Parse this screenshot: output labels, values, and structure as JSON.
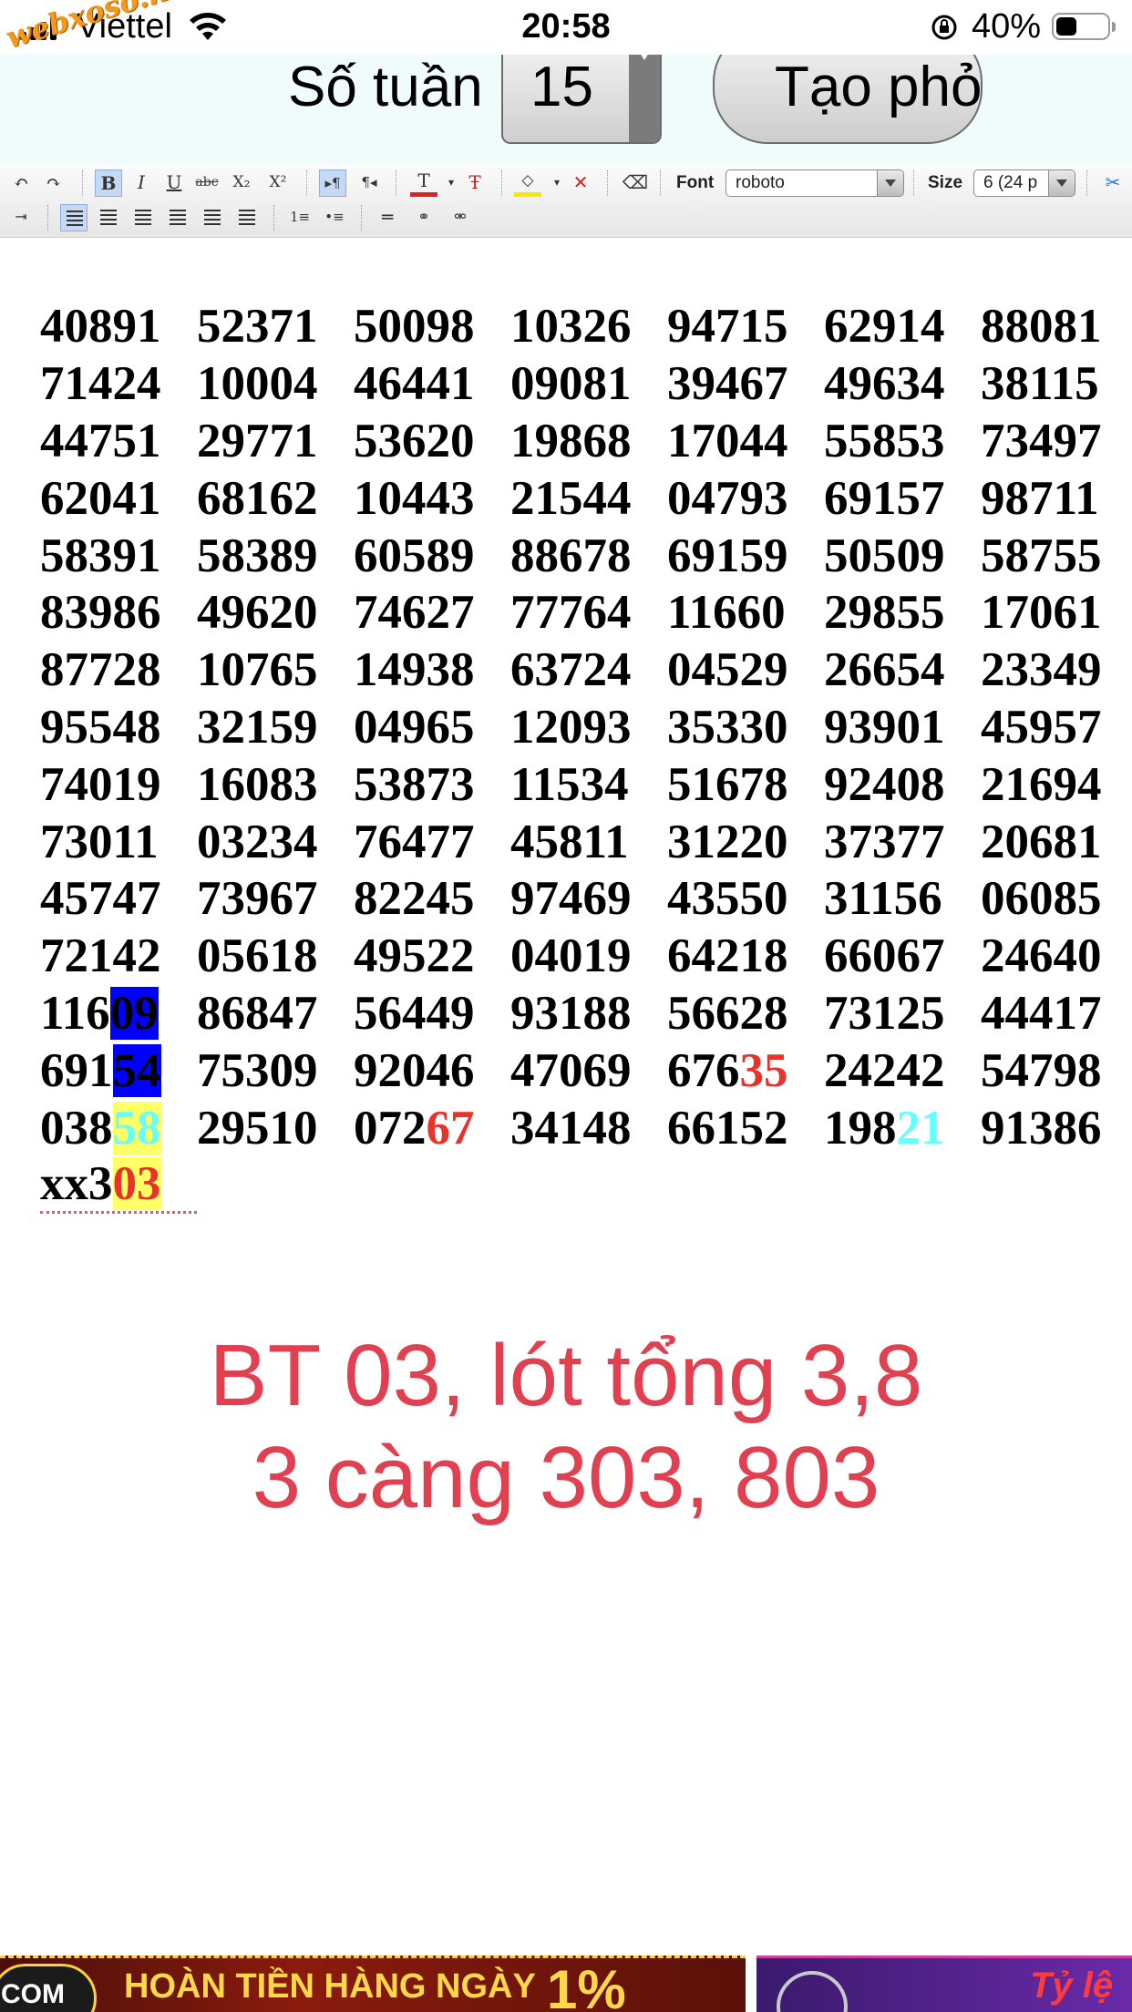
{
  "status_bar": {
    "carrier": "Viettel",
    "time": "20:58",
    "battery_percent": "40%",
    "battery_level": 0.4
  },
  "watermark": "webxoso.net",
  "form": {
    "weeks_label": "Số tuần",
    "weeks_value": "15",
    "generate_label": "Tạo phỏ"
  },
  "toolbar": {
    "font_label": "Font",
    "font_value": "roboto",
    "size_label": "Size",
    "size_value": "6 (24 p"
  },
  "numbers": [
    [
      "40891",
      "52371",
      "50098",
      "10326",
      "94715",
      "62914",
      "88081"
    ],
    [
      "71424",
      "10004",
      "46441",
      "09081",
      "39467",
      "49634",
      "38115"
    ],
    [
      "44751",
      "29771",
      "53620",
      "19868",
      "17044",
      "55853",
      "73497"
    ],
    [
      "62041",
      "68162",
      "10443",
      "21544",
      "04793",
      "69157",
      "98711"
    ],
    [
      "58391",
      "58389",
      "60589",
      "88678",
      "69159",
      "50509",
      "58755"
    ],
    [
      "83986",
      "49620",
      "74627",
      "77764",
      "11660",
      "29855",
      "17061"
    ],
    [
      "87728",
      "10765",
      "14938",
      "63724",
      "04529",
      "26654",
      "23349"
    ],
    [
      "95548",
      "32159",
      "04965",
      "12093",
      "35330",
      "93901",
      "45957"
    ],
    [
      "74019",
      "16083",
      "53873",
      "11534",
      "51678",
      "92408",
      "21694"
    ],
    [
      "73011",
      "03234",
      "76477",
      "45811",
      "31220",
      "37377",
      "20681"
    ],
    [
      "45747",
      "73967",
      "82245",
      "97469",
      "43550",
      "31156",
      "06085"
    ],
    [
      "72142",
      "05618",
      "49522",
      "04019",
      "64218",
      "66067",
      "24640"
    ],
    [
      "11609",
      "86847",
      "56449",
      "93188",
      "56628",
      "73125",
      "44417"
    ],
    [
      "69154",
      "75309",
      "92046",
      "47069",
      "67635",
      "24242",
      "54798"
    ],
    [
      "03858",
      "29510",
      "07267",
      "34148",
      "66152",
      "19821",
      "91386"
    ],
    [
      "xx303"
    ]
  ],
  "message": {
    "line1": "BT 03, lót tổng 3,8",
    "line2": "3 càng 303, 803"
  },
  "banner": {
    "left_badge": "COM",
    "left_text": "HOÀN TIỀN HÀNG NGÀY",
    "left_percent": "1%",
    "right_text": "Tỷ lệ"
  }
}
